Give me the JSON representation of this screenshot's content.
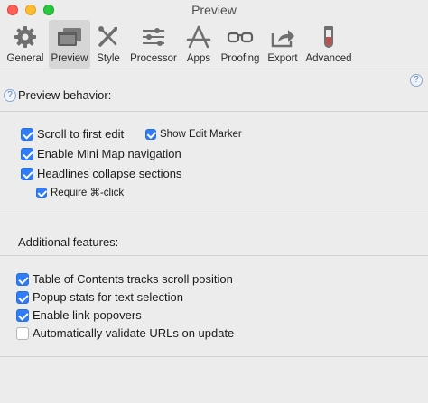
{
  "window": {
    "title": "Preview"
  },
  "toolbar": {
    "items": [
      {
        "label": "General",
        "icon": "gear-icon",
        "selected": false
      },
      {
        "label": "Preview",
        "icon": "preview-window-icon",
        "selected": true
      },
      {
        "label": "Style",
        "icon": "style-tools-icon",
        "selected": false
      },
      {
        "label": "Processor",
        "icon": "sliders-icon",
        "selected": false
      },
      {
        "label": "Apps",
        "icon": "apps-icon",
        "selected": false
      },
      {
        "label": "Proofing",
        "icon": "glasses-icon",
        "selected": false
      },
      {
        "label": "Export",
        "icon": "export-icon",
        "selected": false
      },
      {
        "label": "Advanced",
        "icon": "test-tube-icon",
        "selected": false
      }
    ]
  },
  "preview_behavior": {
    "title": "Preview behavior:",
    "options": {
      "scroll_first_edit": {
        "label": "Scroll to first edit",
        "checked": true
      },
      "show_edit_marker": {
        "label": "Show Edit Marker",
        "checked": true
      },
      "mini_map": {
        "label": "Enable Mini Map navigation",
        "checked": true
      },
      "headlines_collapse": {
        "label": "Headlines collapse sections",
        "checked": true
      },
      "require_cmd_click": {
        "label": "Require ⌘-click",
        "checked": true
      }
    }
  },
  "additional_features": {
    "title": "Additional features:",
    "options": {
      "toc_tracks": {
        "label": "Table of Contents tracks scroll position",
        "checked": true
      },
      "popup_stats": {
        "label": "Popup stats for text selection",
        "checked": true
      },
      "link_popovers": {
        "label": "Enable link popovers",
        "checked": true
      },
      "validate_urls": {
        "label": "Automatically validate URLs on update",
        "checked": false
      }
    }
  },
  "help": {
    "glyph": "?"
  },
  "colors": {
    "accent": "#2f7cf6",
    "window_bg": "#ececec",
    "selected_tab": "#d6d6d6"
  }
}
